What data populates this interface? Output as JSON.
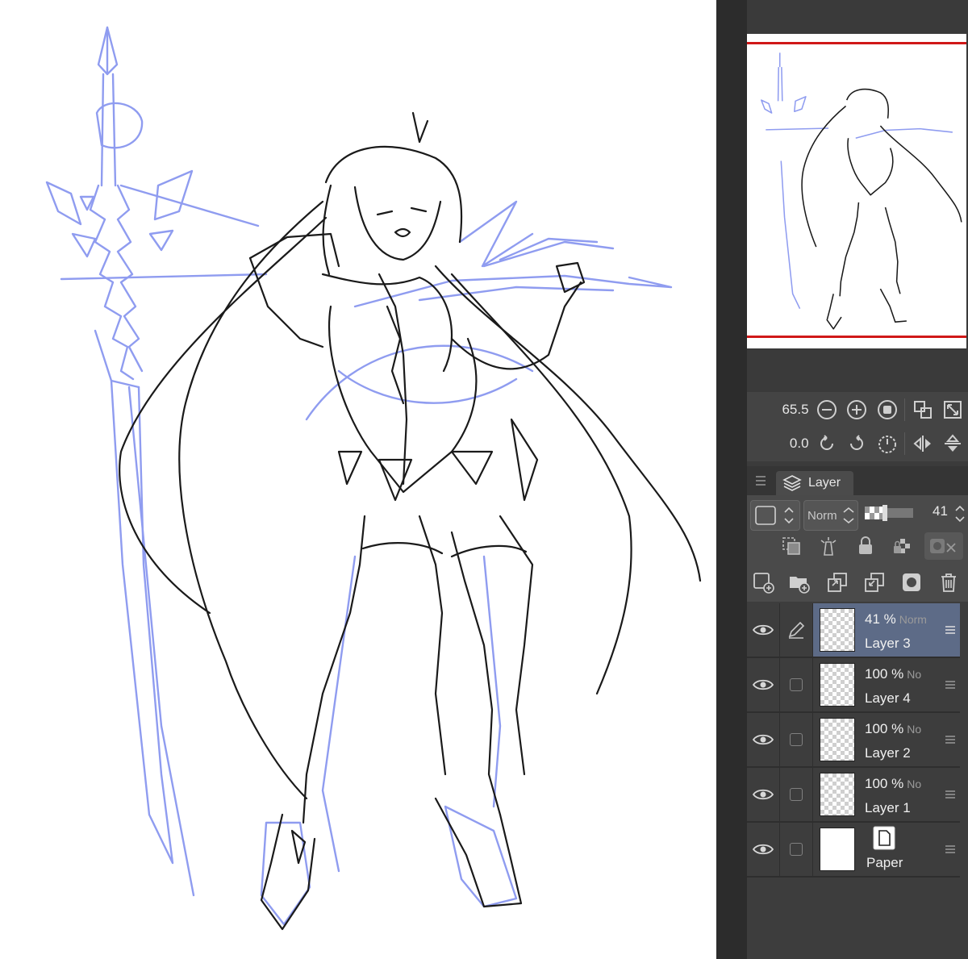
{
  "navigator": {
    "zoom_value": "65.5",
    "rotate_value": "0.0"
  },
  "layer_panel": {
    "tab_label": "Layer",
    "blend_mode": "Norm",
    "opacity": "41"
  },
  "layers": [
    {
      "opacity": "41 %",
      "mode": "Norm",
      "name": "Layer 3",
      "active": true
    },
    {
      "opacity": "100 %",
      "mode": "No",
      "name": "Layer 4"
    },
    {
      "opacity": "100 %",
      "mode": "No",
      "name": "Layer 2"
    },
    {
      "opacity": "100 %",
      "mode": "No",
      "name": "Layer 1"
    },
    {
      "name": "Paper"
    }
  ],
  "colors": {
    "sketch_line": "#1a1a1a",
    "guide_blue": "#8f9cf0",
    "nav_frame": "#d01818",
    "active_layer": "#5d6b87"
  }
}
